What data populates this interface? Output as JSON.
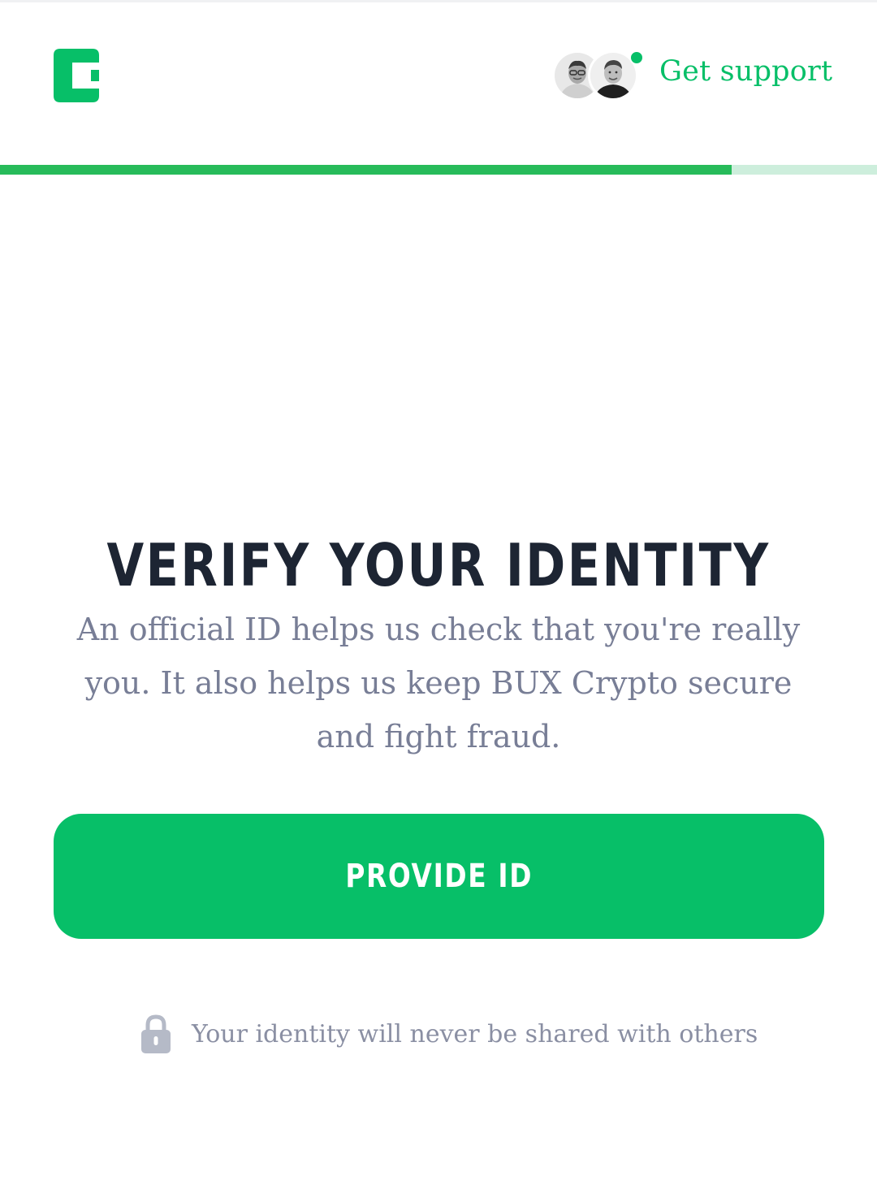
{
  "colors": {
    "brand": "#07bf68",
    "progress": "#27bb5a",
    "progress_track": "#cdeedc",
    "heading": "#1d2533",
    "body_text": "#787e96"
  },
  "header": {
    "logo_icon": "bux-crypto-logo-icon",
    "support_avatars": [
      "support-agent-avatar",
      "support-agent-avatar"
    ],
    "online_indicator": "online-status-dot",
    "support_link": "Get support"
  },
  "progress": {
    "fraction": 0.834
  },
  "main": {
    "title": "VERIFY YOUR IDENTITY",
    "description": "An official ID helps us check that you're really you. It also helps us keep BUX Crypto secure and fight fraud.",
    "cta_label": "PROVIDE ID"
  },
  "footer": {
    "lock_icon": "lock-icon",
    "privacy_note": "Your identity will never be shared with others"
  }
}
